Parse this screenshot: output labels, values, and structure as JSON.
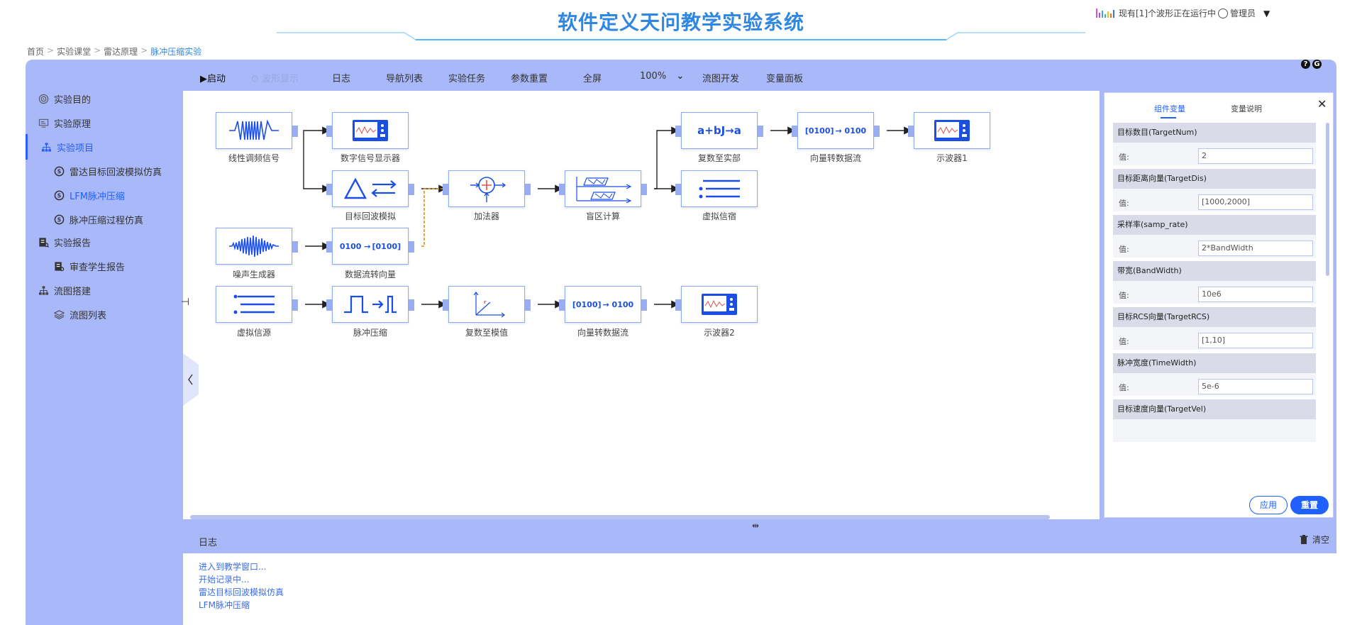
{
  "header": {
    "title": "软件定义天问教学实验系统",
    "status_text": "现有[1]个波形正在运行中",
    "user_label": "管理员",
    "bar_colors": [
      "#e64bd6",
      "#8a5cf0",
      "#3aa0f0",
      "#21c7a0",
      "#f0c020",
      "#f07020",
      "#3a6cf0"
    ]
  },
  "breadcrumb": {
    "items": [
      "首页",
      "实验课堂",
      "雷达原理",
      "脉冲压缩实验"
    ],
    "separator": ">"
  },
  "sidebar": {
    "items": [
      {
        "label": "实验目的",
        "icon": "target-icon",
        "level": 0,
        "active": false
      },
      {
        "label": "实验原理",
        "icon": "monitor-icon",
        "level": 0,
        "active": false
      },
      {
        "label": "实验项目",
        "icon": "hierarchy-icon",
        "level": 0,
        "active": true
      },
      {
        "label": "雷达目标回波模拟仿真",
        "icon": "course-icon",
        "level": 1,
        "active": false
      },
      {
        "label": "LFM脉冲压缩",
        "icon": "course-icon",
        "level": 1,
        "active": true
      },
      {
        "label": "脉冲压缩过程仿真",
        "icon": "course-icon",
        "level": 1,
        "active": false
      },
      {
        "label": "实验报告",
        "icon": "report-icon",
        "level": 0,
        "active": false
      },
      {
        "label": "审查学生报告",
        "icon": "review-icon",
        "level": 1,
        "active": false
      },
      {
        "label": "流图搭建",
        "icon": "hierarchy-icon",
        "level": 0,
        "active": false
      },
      {
        "label": "流图列表",
        "icon": "layers-icon",
        "level": 1,
        "active": false
      }
    ]
  },
  "toolbar": {
    "start": "▶启动",
    "waveform": "波形显示",
    "log": "日志",
    "nav_list": "导航列表",
    "task": "实验任务",
    "param_reset": "参数重置",
    "fullscreen": "全屏",
    "zoom": "100%",
    "flow_dev": "流图开发",
    "var_panel": "变量面板",
    "help": "?",
    "help2": "G"
  },
  "blocks": {
    "lfm": {
      "label": "线性调频信号",
      "icon": "chirp-wave-icon"
    },
    "scope_digital": {
      "label": "数字信号显示器",
      "icon": "oscilloscope-icon"
    },
    "complex_real": {
      "label": "复数至实部",
      "icon": "complex-real-icon",
      "glyph": "a+bJ→a"
    },
    "vec_stream_top": {
      "label": "向量转数据流",
      "icon": "vector-stream-icon",
      "glyph_a": "[0100]",
      "glyph_b": "→ 0100"
    },
    "scope1": {
      "label": "示波器1",
      "icon": "oscilloscope-icon"
    },
    "echo_sim": {
      "label": "目标回波模拟",
      "icon": "echo-sim-icon"
    },
    "adder": {
      "label": "加法器",
      "icon": "adder-icon"
    },
    "blind_zone": {
      "label": "盲区计算",
      "icon": "blind-zone-icon"
    },
    "virtual_sink": {
      "label": "虚拟信宿",
      "icon": "list-lines-icon"
    },
    "noise": {
      "label": "噪声生成器",
      "icon": "noise-wave-icon"
    },
    "stream_vec": {
      "label": "数据流转向量",
      "icon": "stream-vector-icon",
      "glyph_a": "0100 →",
      "glyph_b": "[0100]"
    },
    "virtual_source": {
      "label": "虚拟信源",
      "icon": "list-lines-icon"
    },
    "pulse_comp": {
      "label": "脉冲压缩",
      "icon": "pulse-compress-icon"
    },
    "complex_mag": {
      "label": "复数至模值",
      "icon": "complex-mag-icon"
    },
    "vec_stream_bottom": {
      "label": "向量转数据流",
      "icon": "vector-stream-icon",
      "glyph_a": "[0100]",
      "glyph_b": "→ 0100"
    },
    "scope2": {
      "label": "示波器2",
      "icon": "oscilloscope-icon"
    }
  },
  "panel": {
    "tabs": [
      "组件变量",
      "变量说明"
    ],
    "active_tab": 0,
    "value_label": "值:",
    "variables": [
      {
        "name": "目标数目(TargetNum)",
        "value": "2"
      },
      {
        "name": "目标距离向量(TargetDis)",
        "value": "[1000,2000]"
      },
      {
        "name": "采样率(samp_rate)",
        "value": "2*BandWidth"
      },
      {
        "name": "带宽(BandWidth)",
        "value": "10e6"
      },
      {
        "name": "目标RCS向量(TargetRCS)",
        "value": "[1,10]"
      },
      {
        "name": "脉冲宽度(TimeWidth)",
        "value": "5e-6"
      },
      {
        "name": "目标速度向量(TargetVel)",
        "value": ""
      }
    ],
    "apply": "应用",
    "reset": "重置",
    "close": "✕"
  },
  "log": {
    "title": "日志",
    "clear": "清空",
    "lines": [
      "进入到教学窗口...",
      "开始记录中...",
      "雷达目标回波模拟仿真",
      "LFM脉冲压缩"
    ]
  },
  "colors": {
    "accent": "#2060ff",
    "frame": "#a9b8f8",
    "block_blue": "#1b4fe3",
    "title": "#2f87e0"
  }
}
